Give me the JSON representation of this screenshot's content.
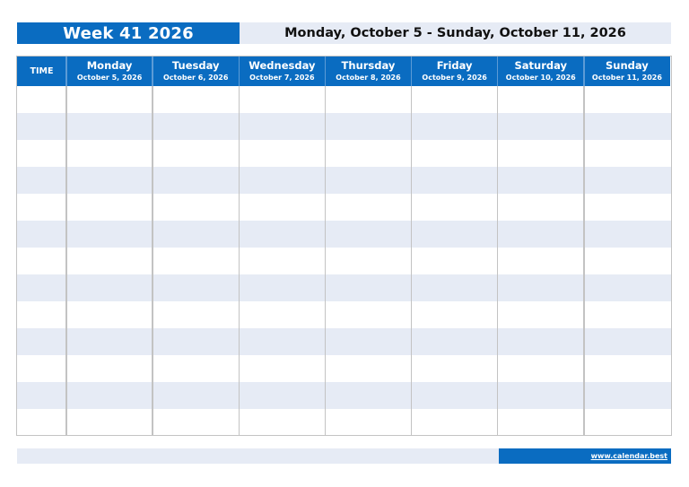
{
  "header": {
    "week_title": "Week 41 2026",
    "date_range": "Monday, October 5 - Sunday, October 11, 2026"
  },
  "table": {
    "time_label": "TIME",
    "days": [
      {
        "day": "Monday",
        "date": "October 5, 2026"
      },
      {
        "day": "Tuesday",
        "date": "October 6, 2026"
      },
      {
        "day": "Wednesday",
        "date": "October 7, 2026"
      },
      {
        "day": "Thursday",
        "date": "October 8, 2026"
      },
      {
        "day": "Friday",
        "date": "October 9, 2026"
      },
      {
        "day": "Saturday",
        "date": "October 10, 2026"
      },
      {
        "day": "Sunday",
        "date": "October 11, 2026"
      }
    ],
    "row_count": 13
  },
  "footer": {
    "link_text": "www.calendar.best"
  },
  "colors": {
    "accent": "#0a6cc1",
    "shade": "#e6ebf5",
    "grid": "#c3c3c3"
  }
}
